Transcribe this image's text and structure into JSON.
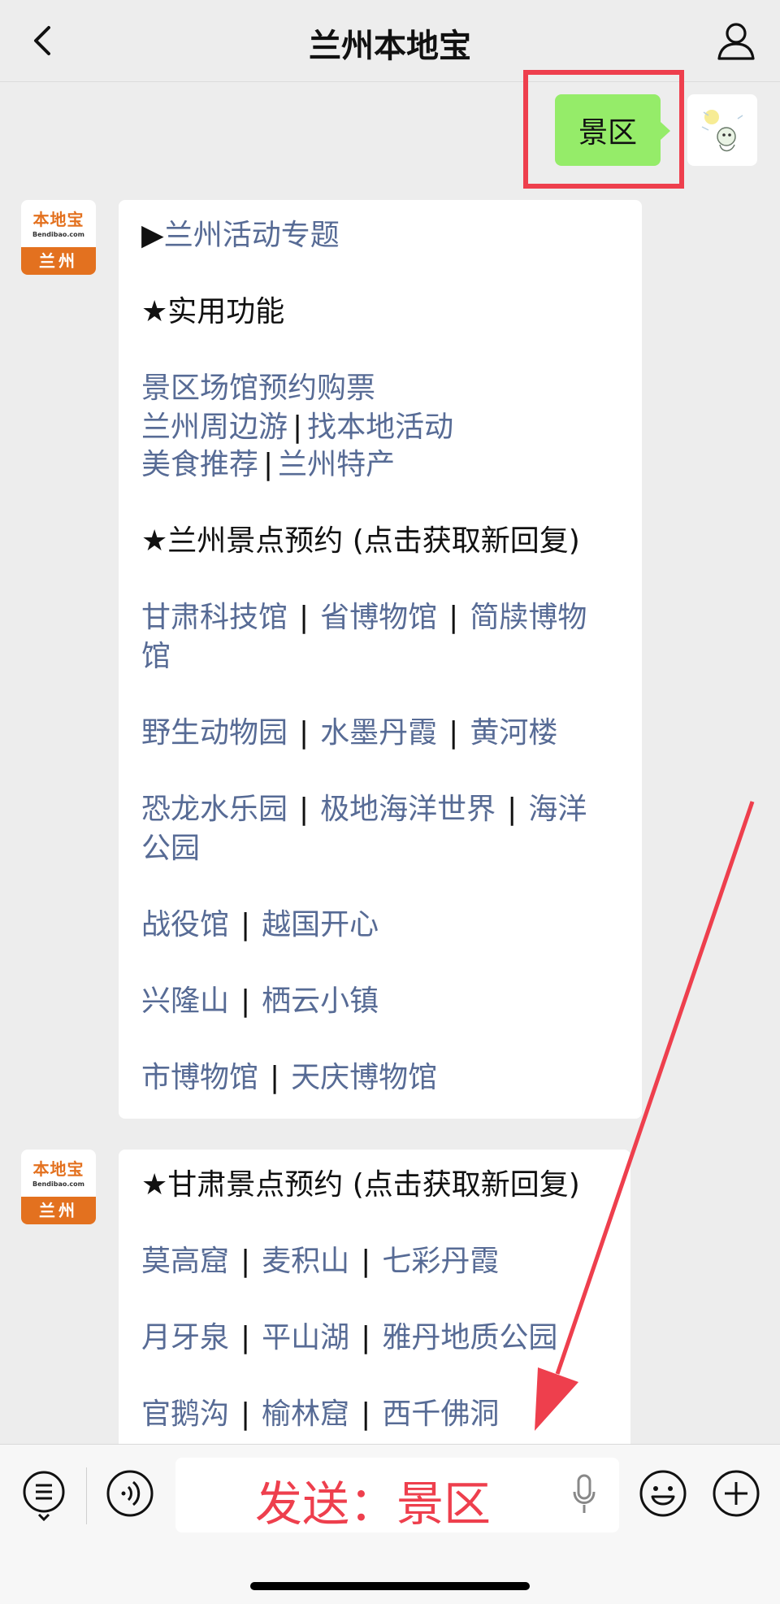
{
  "header": {
    "title": "兰州本地宝"
  },
  "sent_message": {
    "text": "景区"
  },
  "avatar": {
    "brand": "本地宝",
    "url": "Bendibao.com",
    "city": "兰州"
  },
  "message1": {
    "topic_link": "兰州活动专题",
    "func_title": "★实用功能",
    "func_link1": "景区场馆预约购票",
    "func_link2": "兰州周边游",
    "func_link3": "找本地活动",
    "func_link4": "美食推荐",
    "func_link5": "兰州特产",
    "lz_title": "★兰州景点预约 (点击获取新回复)",
    "lz_links": {
      "a": "甘肃科技馆",
      "b": "省博物馆",
      "c": "简牍博物",
      "c2": "馆",
      "d": "野生动物园",
      "e": "水墨丹霞",
      "f": "黄河楼",
      "g": "恐龙水乐园",
      "h": "极地海洋世界",
      "i": "海洋",
      "i2": "公园",
      "j": "战役馆",
      "k": "越国开心",
      "l": "兴隆山",
      "m": "栖云小镇",
      "n": "市博物馆",
      "o": "天庆博物馆"
    }
  },
  "message2": {
    "gs_title": "★甘肃景点预约 (点击获取新回复)",
    "gs_links": {
      "a": "莫高窟",
      "b": "麦积山",
      "c": "七彩丹霞",
      "d": "月牙泉",
      "e": "平山湖",
      "f": "雅丹地质公园",
      "g": "官鹅沟",
      "h": "榆林窟",
      "i": "西千佛洞"
    }
  },
  "input": {
    "annotation": "发送：景区"
  },
  "colors": {
    "link": "#576b95",
    "sent_bubble": "#95ec69",
    "annotation_red": "#ee3f4d",
    "brand_orange": "#e3711f"
  }
}
